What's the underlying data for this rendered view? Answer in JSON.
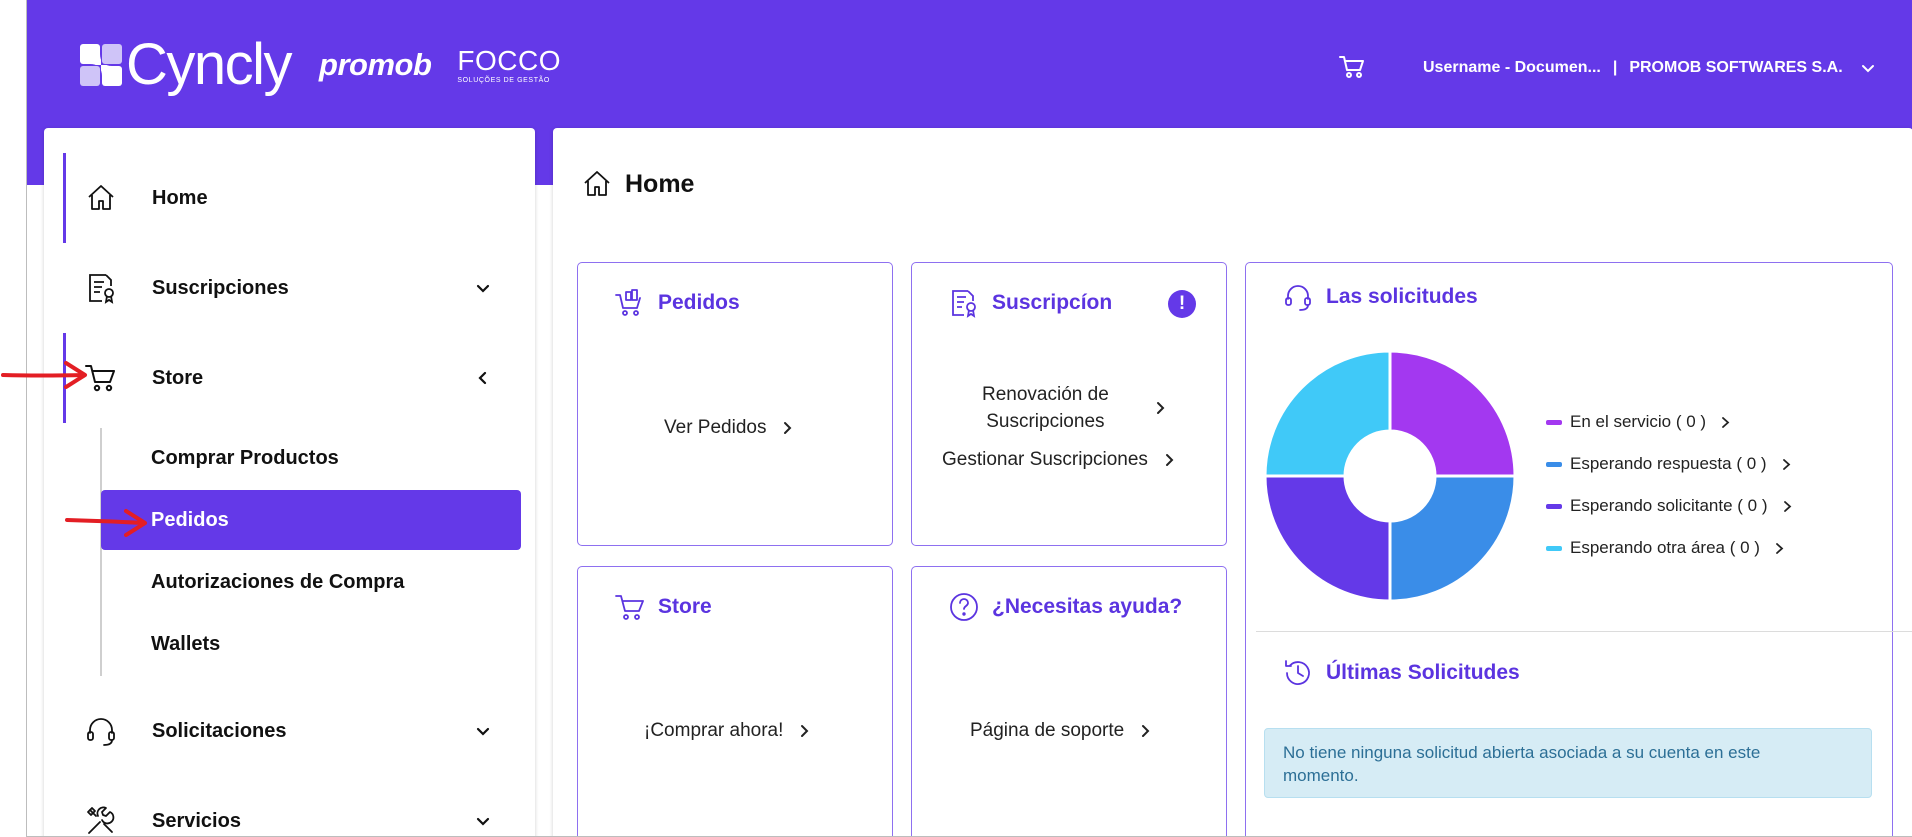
{
  "header": {
    "brand_cyncly": "Cyncly",
    "brand_promob": "promob",
    "brand_focco": "FOCCO",
    "brand_focco_sub": "SOLUÇÕES DE GESTÃO",
    "cart_icon": "cart-icon",
    "username": "Username - Documen...",
    "separator": "|",
    "company": "PROMOB SOFTWARES S.A."
  },
  "sidebar": {
    "items": [
      {
        "label": "Home",
        "icon": "home-icon"
      },
      {
        "label": "Suscripciones",
        "icon": "subscription-icon"
      },
      {
        "label": "Store",
        "icon": "cart-icon"
      },
      {
        "label": "Solicitaciones",
        "icon": "headset-icon"
      },
      {
        "label": "Servicios",
        "icon": "tools-icon"
      }
    ],
    "store_sub_items": [
      {
        "label": "Comprar Productos"
      },
      {
        "label": "Pedidos",
        "active": true
      },
      {
        "label": "Autorizaciones de Compra"
      },
      {
        "label": "Wallets"
      }
    ]
  },
  "main": {
    "title": "Home",
    "cards": {
      "pedidos": {
        "title": "Pedidos",
        "link": "Ver Pedidos"
      },
      "suscripcion": {
        "title": "Suscripcíon",
        "link1_line1": "Renovación de",
        "link1_line2": "Suscripciones",
        "link2": "Gestionar Suscripciones",
        "alert": "!"
      },
      "store": {
        "title": "Store",
        "link": "¡Comprar ahora!"
      },
      "ayuda": {
        "title": "¿Necesitas ayuda?",
        "link": "Página de soporte"
      },
      "solicitudes": {
        "title": "Las solicitudes",
        "legend": [
          {
            "label": "En el servicio ( 0 )",
            "color": "#a338f0"
          },
          {
            "label": "Esperando respuesta ( 0 )",
            "color": "#3a8de8"
          },
          {
            "label": "Esperando solicitante ( 0 )",
            "color": "#6439e8"
          },
          {
            "label": "Esperando otra área ( 0 )",
            "color": "#40c9f8"
          }
        ],
        "last_title": "Últimas Solicitudes",
        "info_line1": "No tiene ninguna solicitud abierta asociada a su cuenta en este",
        "info_line2": "momento."
      }
    }
  },
  "colors": {
    "brand": "#6439e8",
    "accent_text": "#5b34e0",
    "info_bg": "#d6ecf5",
    "annotation": "#e31e24"
  }
}
